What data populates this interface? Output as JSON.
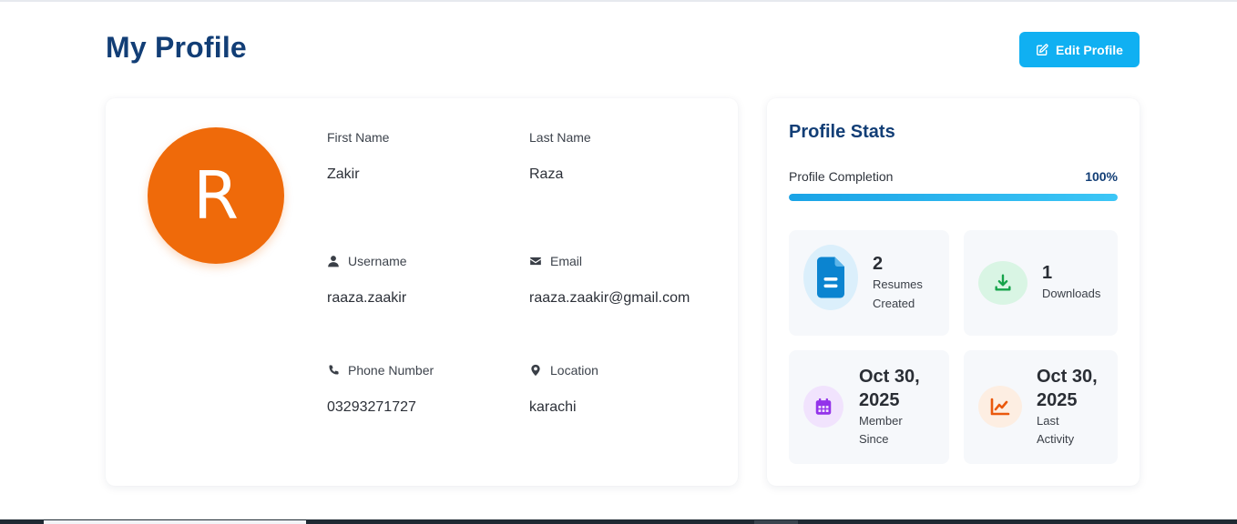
{
  "page": {
    "title": "My Profile"
  },
  "toolbar": {
    "edit_label": "Edit Profile"
  },
  "profile": {
    "avatar_initial": "R",
    "avatar_color": "#ef6a0a",
    "first_name": {
      "label": "First Name",
      "value": "Zakir"
    },
    "last_name": {
      "label": "Last Name",
      "value": "Raza"
    },
    "username": {
      "label": "Username",
      "value": "raaza.zaakir"
    },
    "email": {
      "label": "Email",
      "value": "raaza.zaakir@gmail.com"
    },
    "phone": {
      "label": "Phone Number",
      "value": "03293271727"
    },
    "location": {
      "label": "Location",
      "value": "karachi"
    }
  },
  "stats": {
    "title": "Profile Stats",
    "completion_label": "Profile Completion",
    "completion_value": "100%",
    "completion_fraction": 1.0,
    "tiles": [
      {
        "number": "2",
        "line1": "Resumes",
        "line2": "Created",
        "icon": "document-icon",
        "color": "#0b84d0"
      },
      {
        "number": "1",
        "line1": "Downloads",
        "icon": "download-icon",
        "color": "#16a34a"
      },
      {
        "date_line1": "Oct 30,",
        "date_line2": "2025",
        "line1": "Member",
        "line2": "Since",
        "icon": "calendar-icon",
        "color": "#9333ea"
      },
      {
        "date_line1": "Oct 30,",
        "date_line2": "2025",
        "line1": "Last",
        "line2": "Activity",
        "icon": "chart-line-icon",
        "color": "#ea580c"
      }
    ]
  },
  "colors": {
    "brand": "#123e76",
    "accent": "#10b0f2"
  }
}
